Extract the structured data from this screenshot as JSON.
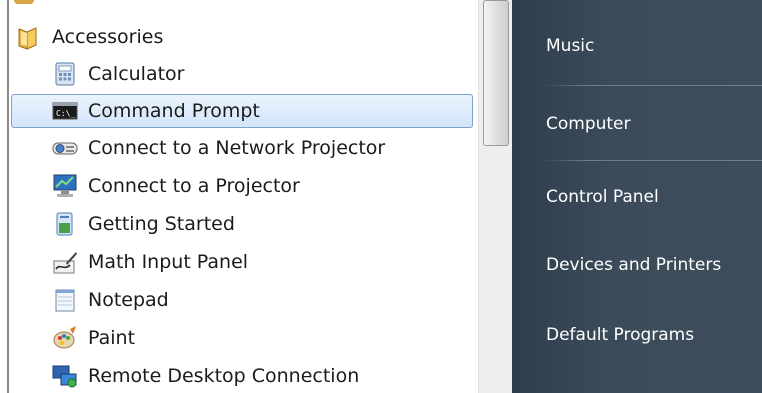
{
  "programs": {
    "folder": {
      "label": "Accessories",
      "icon": "folder-icon"
    },
    "items": [
      {
        "label": "Calculator",
        "icon": "calculator-icon"
      },
      {
        "label": "Command Prompt",
        "icon": "command-prompt-icon",
        "selected": true
      },
      {
        "label": "Connect to a Network Projector",
        "icon": "network-projector-icon"
      },
      {
        "label": "Connect to a Projector",
        "icon": "projector-icon"
      },
      {
        "label": "Getting Started",
        "icon": "getting-started-icon"
      },
      {
        "label": "Math Input Panel",
        "icon": "math-input-icon"
      },
      {
        "label": "Notepad",
        "icon": "notepad-icon"
      },
      {
        "label": "Paint",
        "icon": "paint-icon"
      },
      {
        "label": "Remote Desktop Connection",
        "icon": "remote-desktop-icon"
      }
    ]
  },
  "right_pane": {
    "items": [
      {
        "label": "Music"
      },
      {
        "label": "Computer"
      },
      {
        "label": "Control Panel"
      },
      {
        "label": "Devices and Printers"
      },
      {
        "label": "Default Programs"
      }
    ]
  },
  "colors": {
    "selection_border": "#7da2ce",
    "right_pane_bg": "#3b4b5a"
  }
}
